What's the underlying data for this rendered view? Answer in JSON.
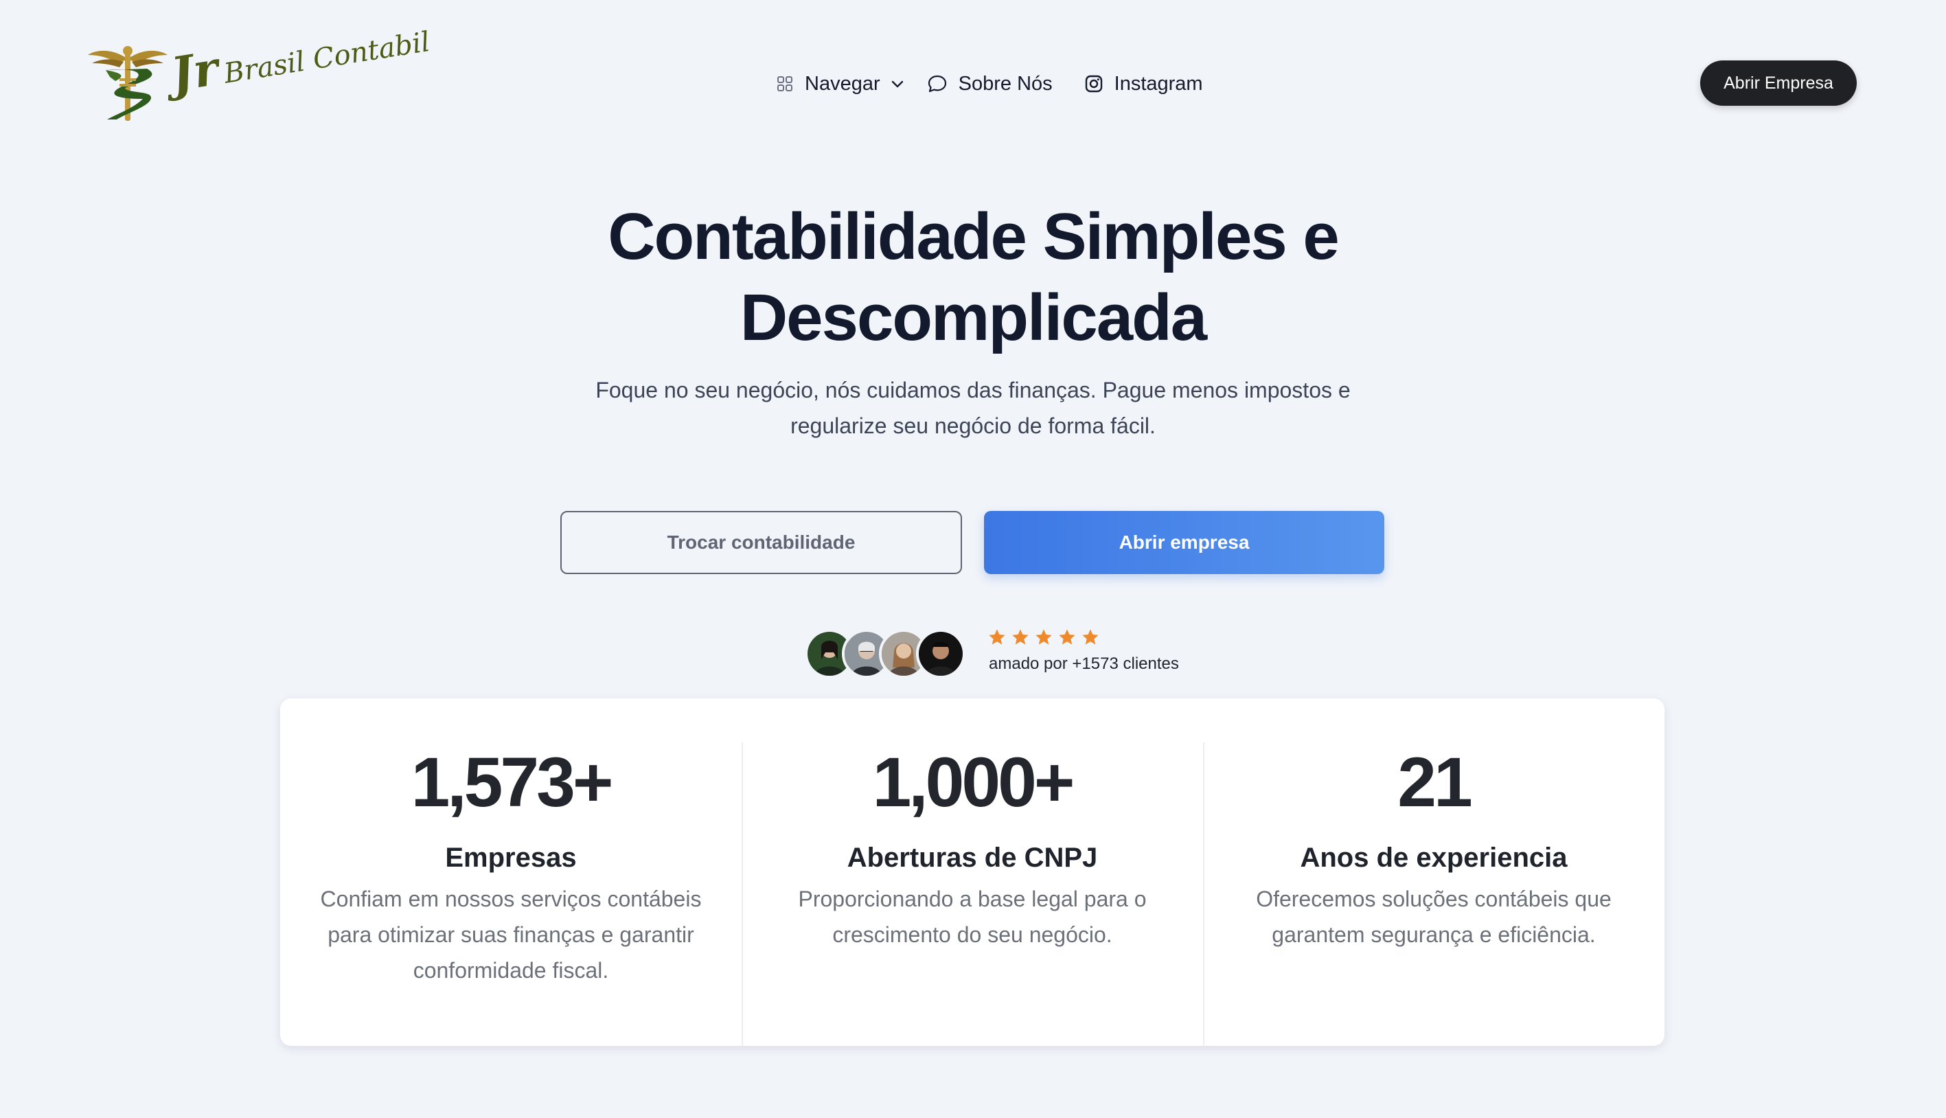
{
  "brand": {
    "logo_text_main": "Jr",
    "logo_text_sub": "Brasil Contabil",
    "logo_icon": "caduceus-icon",
    "logo_color": "#4e5a17"
  },
  "nav": {
    "browse_label": "Navegar",
    "about_label": "Sobre Nós",
    "instagram_label": "Instagram",
    "icons": [
      "grid-icon",
      "chevron-down-icon",
      "chat-bubble-icon",
      "instagram-icon"
    ]
  },
  "header_cta": "Abrir Empresa",
  "hero": {
    "title_line1": "Contabilidade Simples e",
    "title_line2": "Descomplicada",
    "subtitle_line1": "Foque no seu negócio, nós cuidamos das finanças. Pague menos impostos e",
    "subtitle_line2": "regularize seu negócio de forma fácil."
  },
  "buttons": {
    "switch_accounting": "Trocar contabilidade",
    "open_company": "Abrir empresa"
  },
  "social_proof": {
    "rating": 5,
    "rating_max": 5,
    "text": "amado por +1573 clientes",
    "star_color": "#ee8a2c"
  },
  "stats": [
    {
      "number": "1,573+",
      "title": "Empresas",
      "desc_line1": "Confiam em nossos serviços contábeis",
      "desc_line2": "para otimizar suas finanças e garantir",
      "desc_line3": "conformidade fiscal."
    },
    {
      "number": "1,000+",
      "title": "Aberturas de CNPJ",
      "desc_line1": "Proporcionando a base legal para o",
      "desc_line2": "crescimento do seu negócio.",
      "desc_line3": ""
    },
    {
      "number": "21",
      "title": "Anos de experiencia",
      "desc_line1": "Oferecemos soluções contábeis que",
      "desc_line2": "garantem segurança e eficiência.",
      "desc_line3": ""
    }
  ],
  "colors": {
    "background": "#f1f4f9",
    "primary": "#3c77e4",
    "dark_button": "#1f2124"
  }
}
